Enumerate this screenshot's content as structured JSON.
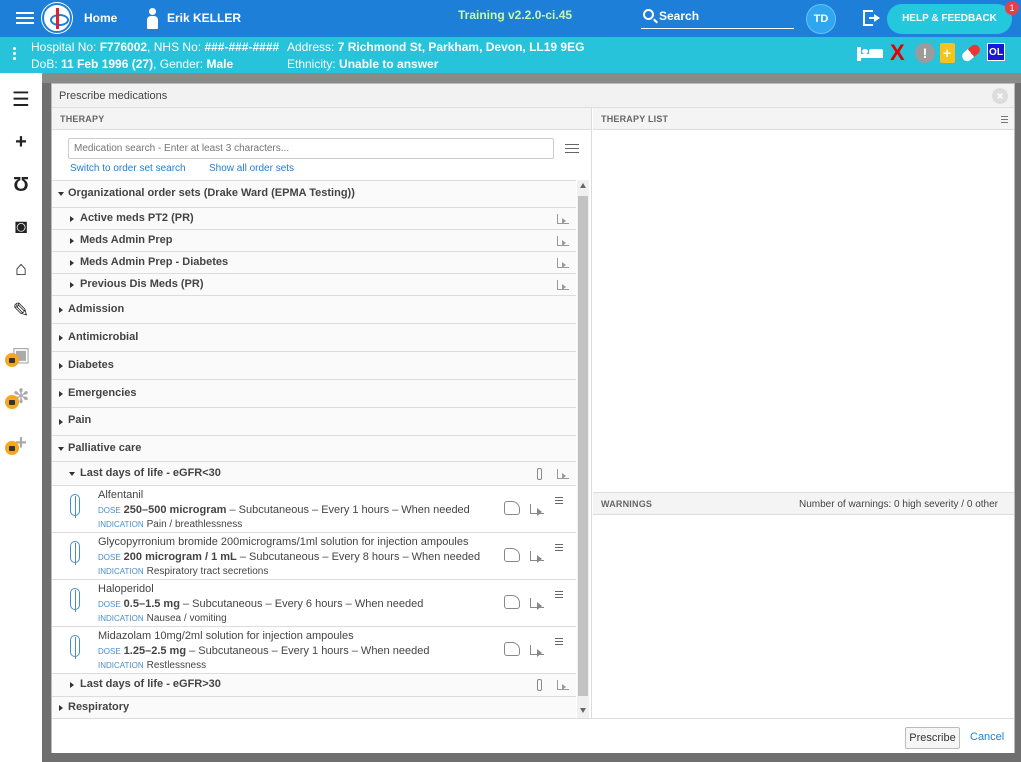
{
  "topbar": {
    "home": "Home",
    "user": "Erik KELLER",
    "training": "Training v2.2.0-ci.45",
    "search": "Search",
    "avatar": "TD",
    "help": "HELP & FEEDBACK",
    "badge": "1"
  },
  "banner": {
    "hospital_label": "Hospital No: ",
    "hospital_no": "F776002",
    "nhs_label": ", NHS No: ",
    "nhs_no": "###-###-####",
    "dob_label": "DoB: ",
    "dob": "11 Feb 1996 (27)",
    "gender_label": ", Gender: ",
    "gender": "Male",
    "address_label": "Address: ",
    "address": "7 Richmond St, Parkham, Devon, LL19 9EG",
    "ethnicity_label": "Ethnicity: ",
    "ethnicity": "Unable to answer",
    "x": "X",
    "warn": "!",
    "ol": "OL"
  },
  "dialog": {
    "title": "Prescribe medications",
    "close": "×",
    "therapy_header": "THERAPY",
    "therapy_list_header": "THERAPY LIST",
    "warnings_header": "WARNINGS",
    "warnings_count": "Number of warnings: 0 high severity / 0 other",
    "search_placeholder": "Medication search - Enter at least 3 characters...",
    "link_order_set": "Switch to order set search",
    "link_show_all": "Show all order sets",
    "prescribe": "Prescribe",
    "cancel": "Cancel"
  },
  "tree": {
    "org": "Organizational order sets (Drake Ward (EPMA Testing))",
    "org_children": [
      "Active meds PT2 (PR)",
      "Meds Admin Prep",
      "Meds Admin Prep - Diabetes",
      "Previous Dis Meds (PR)"
    ],
    "groups": [
      "Admission",
      "Antimicrobial",
      "Diabetes",
      "Emergencies",
      "Pain"
    ],
    "palliative": "Palliative care",
    "sub1": "Last days of life - eGFR<30",
    "sub2": "Last days of life - eGFR>30",
    "respiratory": "Respiratory",
    "dose_key": "DOSE",
    "indication_key": "INDICATION"
  },
  "meds": [
    {
      "name": "Alfentanil",
      "dose": "250–500 microgram",
      "rest": " – Subcutaneous – Every 1 hours – When needed",
      "indication": "Pain / breathlessness"
    },
    {
      "name": "Glycopyrronium bromide 200micrograms/1ml solution for injection ampoules",
      "dose": "200 microgram / 1 mL",
      "rest": " – Subcutaneous – Every 8 hours – When needed",
      "indication": "Respiratory tract secretions"
    },
    {
      "name": "Haloperidol",
      "dose": "0.5–1.5 mg",
      "rest": " – Subcutaneous – Every 6 hours – When needed",
      "indication": "Nausea / vomiting"
    },
    {
      "name": "Midazolam 10mg/2ml solution for injection ampoules",
      "dose": "1.25–2.5 mg",
      "rest": " – Subcutaneous – Every 1 hours – When needed",
      "indication": "Restlessness"
    }
  ],
  "colors": {
    "topbar": "#1e7fd8",
    "banner": "#27c3da",
    "help": "#23c8dc",
    "training": "#c7f7a8",
    "link": "#1e7fd8"
  }
}
